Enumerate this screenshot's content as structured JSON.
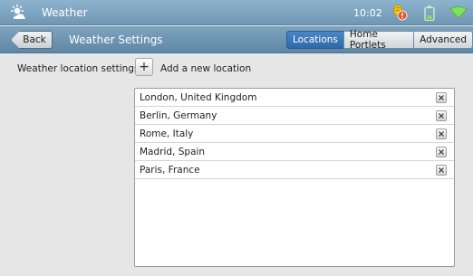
{
  "statusbar": {
    "app_title": "Weather",
    "time": "10:02",
    "icons": [
      "weather-sun-icon",
      "warning-icon",
      "battery-icon",
      "wifi-icon"
    ]
  },
  "navbar": {
    "back_label": "Back",
    "title": "Weather Settings",
    "tabs": [
      {
        "label": "Locations",
        "active": true
      },
      {
        "label": "Home Portlets",
        "active": false
      },
      {
        "label": "Advanced",
        "active": false
      }
    ]
  },
  "content": {
    "settings_label": "Weather location settings:",
    "add_symbol": "+",
    "add_label": "Add a new location",
    "locations": [
      "London, United Kingdom",
      "Berlin, Germany",
      "Rome, Italy",
      "Madrid, Spain",
      "Paris, France"
    ]
  },
  "colors": {
    "header": "#7ea4bf",
    "active_tab": "#3b78b8",
    "background": "#e6e6e6"
  }
}
